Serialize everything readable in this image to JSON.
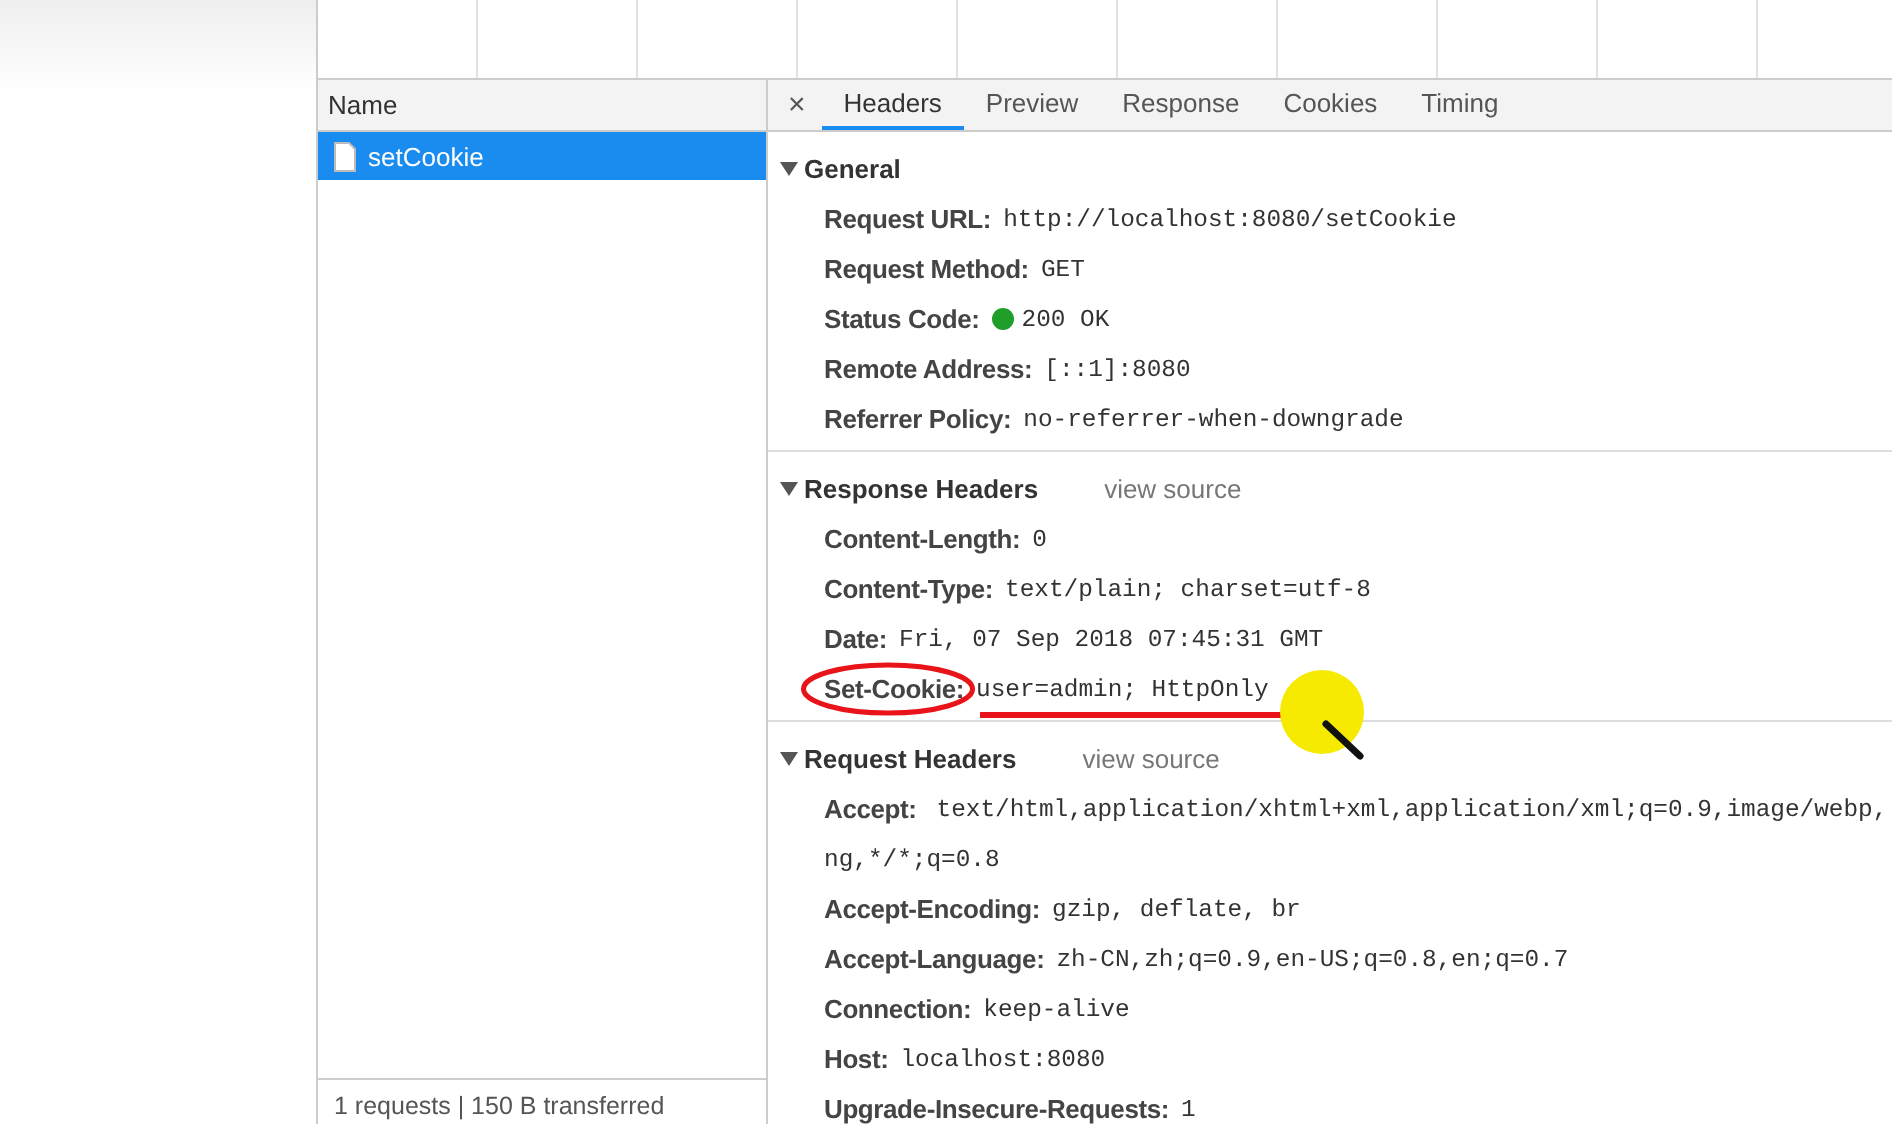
{
  "name_panel": {
    "header": "Name",
    "requests": [
      {
        "name": "setCookie",
        "selected": true
      }
    ],
    "summary": "1 requests | 150 B transferred"
  },
  "detail_tabs": {
    "close": "×",
    "tabs": [
      {
        "label": "Headers",
        "selected": true
      },
      {
        "label": "Preview",
        "selected": false
      },
      {
        "label": "Response",
        "selected": false
      },
      {
        "label": "Cookies",
        "selected": false
      },
      {
        "label": "Timing",
        "selected": false
      }
    ]
  },
  "sections": [
    {
      "title": "General",
      "expanded": true,
      "rows": [
        {
          "kind": "plain",
          "key": "Request URL:",
          "value": [
            "http://localhost:8080/setCookie"
          ],
          "annotated": false
        },
        {
          "kind": "plain",
          "key": "Request Method:",
          "value": [
            "GET"
          ],
          "annotated": false
        },
        {
          "kind": "status",
          "key": "Status Code:",
          "color": "#1f9e2a",
          "value": [
            "200 OK"
          ],
          "annotated": false
        },
        {
          "kind": "plain",
          "key": "Remote Address:",
          "value": [
            "[::1]:8080"
          ],
          "annotated": false
        },
        {
          "kind": "plain",
          "key": "Referrer Policy:",
          "value": [
            "no-referrer-when-downgrade"
          ],
          "annotated": false
        }
      ]
    },
    {
      "title": "Response Headers",
      "expanded": true,
      "link": "view source",
      "rows": [
        {
          "kind": "plain",
          "key": "Content-Length:",
          "value": [
            "0"
          ],
          "annotated": false
        },
        {
          "kind": "plain",
          "key": "Content-Type:",
          "value": [
            "text/plain; charset=utf-8"
          ],
          "annotated": false
        },
        {
          "kind": "plain",
          "key": "Date:",
          "value": [
            "Fri, 07 Sep 2018 07:45:31 GMT"
          ],
          "annotated": false
        },
        {
          "kind": "plain",
          "key": "Set-Cookie:",
          "value": [
            "user=admin; HttpOnly"
          ],
          "annotated": true
        }
      ]
    },
    {
      "title": "Request Headers",
      "expanded": true,
      "link": "view source",
      "rows": [
        {
          "kind": "plain",
          "key": "Accept:",
          "value": [
            "text/html,application/xhtml+xml,application/xml;q=0.9,image/webp,",
            "ng,*/*;q=0.8"
          ]
        },
        {
          "kind": "plain",
          "key": "Accept-Encoding:",
          "value": [
            "gzip, deflate, br"
          ],
          "annotated": false
        },
        {
          "kind": "plain",
          "key": "Accept-Language:",
          "value": [
            "zh-CN,zh;q=0.9,en-US;q=0.8,en;q=0.7"
          ],
          "annotated": false
        },
        {
          "kind": "plain",
          "key": "Connection:",
          "value": [
            "keep-alive"
          ],
          "annotated": false
        },
        {
          "kind": "plain",
          "key": "Host:",
          "value": [
            "localhost:8080"
          ],
          "annotated": false
        },
        {
          "kind": "plain",
          "key": "Upgrade-Insecure-Requests:",
          "value": [
            "1"
          ],
          "annotated": false
        }
      ]
    }
  ]
}
